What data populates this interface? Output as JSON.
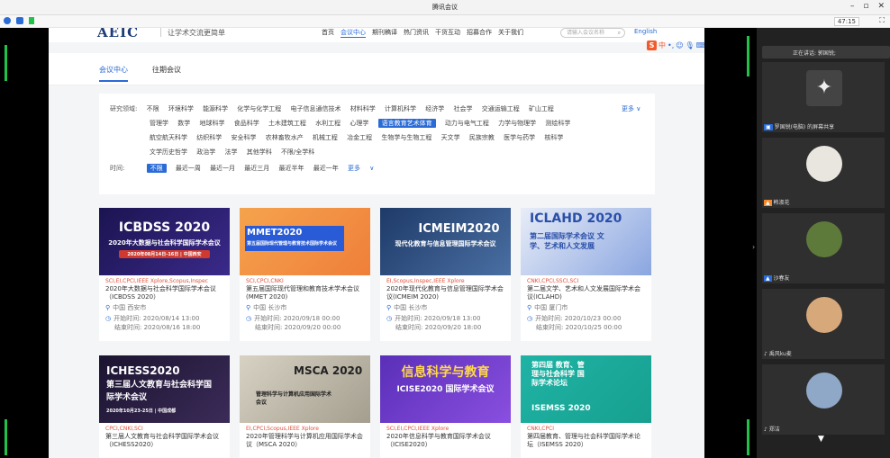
{
  "window": {
    "title": "腾讯会议",
    "timer": "47:15"
  },
  "site": {
    "logo": "AEIC",
    "slogan": "让学术交流更简单",
    "menu": [
      "首页",
      "会议中心",
      "期刊稿译",
      "热门资讯",
      "干货互动",
      "招募合作",
      "关于我们"
    ],
    "search_placeholder": "请输入会议名称",
    "lang": "English",
    "subtabs": [
      "会议中心",
      "往期会议"
    ],
    "filter": {
      "field_label": "研究领域:",
      "fields_row1": [
        "不限",
        "环境科学",
        "能源科学",
        "化学与化学工程",
        "电子信息通信技术",
        "材料科学",
        "计算机科学",
        "经济学",
        "社会学",
        "交通运输工程",
        "矿山工程"
      ],
      "fields_row2": [
        "管理学",
        "数学",
        "地球科学",
        "食品科学",
        "土木建筑工程",
        "水利工程",
        "心理学",
        "语言教育艺术体育",
        "动力与电气工程",
        "力学与物理学",
        "测绘科学"
      ],
      "fields_row3": [
        "航空航天科学",
        "纺织科学",
        "安全科学",
        "农林畜牧水产",
        "机械工程",
        "冶金工程",
        "生物学与生物工程",
        "天文学",
        "民族宗教",
        "医学与药学",
        "核科学"
      ],
      "fields_row4": [
        "文学历史哲学",
        "政治学",
        "法学",
        "其他学科",
        "不限/全学科"
      ],
      "active_field": "语言教育艺术体育",
      "more": "更多",
      "time_label": "时间:",
      "times": [
        "不限",
        "最近一周",
        "最近一月",
        "最近三月",
        "最近半年",
        "最近一年"
      ],
      "time_more": "更多"
    },
    "cards": [
      {
        "banner": "ICBDSS 2020",
        "banner_sub": "2020年大数据与社会科学国际学术会议",
        "banner_date": "2020年08月14日-16日 | 中国西安",
        "tags": "SCI,EI,CPCI,IEEE Xplore,Scopus,Inspec",
        "title": "2020年大数据与社会科学国际学术会议（ICBDSS 2020）",
        "location": "中国 西安市",
        "start": "开始时间:  2020/08/14 13:00",
        "end": "结束时间:  2020/08/16 18:00",
        "color": "#2a1f6e"
      },
      {
        "banner": "MMET2020",
        "banner_sub": "第五届国际现代管理与教育技术国际学术会议",
        "banner_date": "",
        "tags": "SCI,CPCI,CNKI",
        "title": "第五届国际现代管理和教育技术学术会议(MMET 2020)",
        "location": "中国 长沙市",
        "start": "开始时间:  2020/09/18 00:00",
        "end": "结束时间:  2020/09/20 00:00",
        "color": "#f29a44"
      },
      {
        "banner": "ICMEIM2020",
        "banner_sub": "现代化教育与信息管理国际学术会议",
        "banner_date": "",
        "tags": "EI,Scopus,Inspec,IEEE Xplore",
        "title": "2020年现代化教育与信息管理国际学术会议(ICMEIM 2020)",
        "location": "中国 长沙市",
        "start": "开始时间:  2020/09/18 13:00",
        "end": "结束时间:  2020/09/20 18:00",
        "color": "#2c4a7a"
      },
      {
        "banner": "ICLAHD 2020",
        "banner_sub": "第二届国际学术会议 文学、艺术和人文发展",
        "banner_date": "",
        "tags": "CNKI,CPCI,SSCI,SCI",
        "title": "第二届文学、艺术和人文发展国际学术会议(ICLAHD)",
        "location": "中国 厦门市",
        "start": "开始时间:  2020/10/23 00:00",
        "end": "结束时间:  2020/10/25 00:00",
        "color": "#6f8fd0"
      },
      {
        "banner": "ICHESS2020",
        "banner_sub": "第三届人文教育与社会科学国际学术会议",
        "banner_date": "2020年10月23-25日 | 中国成都",
        "tags": "CPCI,CNKI,SCI",
        "title": "第三届人文教育与社会科学国际学术会议（ICHESS2020）",
        "location": "",
        "start": "",
        "end": "",
        "color": "#2b1f44"
      },
      {
        "banner": "MSCA 2020",
        "banner_sub": "管理科学与计算机应用国际学术会议",
        "banner_date": "",
        "tags": "EI,CPCI,Scopus,IEEE Xplore",
        "title": "2020年管理科学与计算机应用国际学术会议（MSCA 2020）",
        "location": "",
        "start": "",
        "end": "",
        "color": "#c9c2b4"
      },
      {
        "banner": "信息科学与教育",
        "banner_sub": "ICISE2020 国际学术会议",
        "banner_date": "",
        "tags": "SCI,EI,CPCI,IEEE Xplore",
        "title": "2020年信息科学与教育国际学术会议（ICISE2020）",
        "location": "",
        "start": "",
        "end": "",
        "color": "#6a3fc3"
      },
      {
        "banner": "ISEMSS 2020",
        "banner_sub": "第四届 教育、管理与社会科学 国际学术论坛",
        "banner_date": "",
        "tags": "CNKI,CPCI",
        "title": "第四届教育、管理与社会科学国际学术论坛（ISEMSS 2020）",
        "location": "",
        "start": "",
        "end": "",
        "color": "#23b3a6"
      }
    ]
  },
  "meeting": {
    "speaking": "正在讲话: 郭国锐;",
    "participants": [
      "罗国锐(电脑) 的屏幕共享",
      "韩淑花",
      "沙春友",
      "禹风ku麦",
      "郑洁"
    ]
  },
  "colors": {
    "accent": "#2a6bd6",
    "tag": "#e0503a",
    "green": "#22c24a"
  }
}
